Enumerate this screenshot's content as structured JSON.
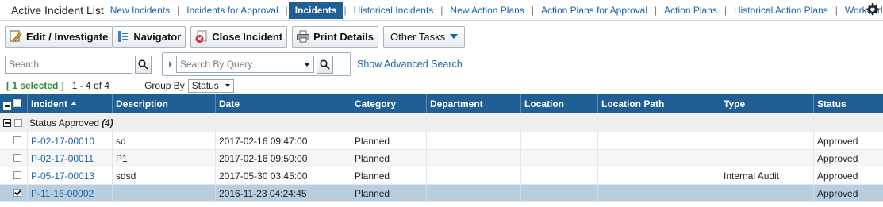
{
  "app_title": "Active Incident List",
  "tabs": [
    {
      "label": "New Incidents"
    },
    {
      "label": "Incidents for Approval"
    },
    {
      "label": "Incidents",
      "active": true
    },
    {
      "label": "Historical Incidents"
    },
    {
      "label": "New Action Plans"
    },
    {
      "label": "Action Plans for Approval"
    },
    {
      "label": "Action Plans"
    },
    {
      "label": "Historical Action Plans"
    },
    {
      "label": "WorkOrd..."
    }
  ],
  "toolbar": {
    "edit_label": "Edit / Investigate",
    "navigator_label": "Navigator",
    "close_label": "Close Incident",
    "print_label": "Print Details",
    "other_label": "Other Tasks"
  },
  "search": {
    "placeholder": "Search",
    "query_placeholder": "Search By Query",
    "advanced_label": "Show Advanced Search"
  },
  "status": {
    "selected": "[ 1 selected ]",
    "count": "1 - 4 of 4",
    "group_by_label": "Group By",
    "group_by_value": "Status"
  },
  "grid": {
    "columns": [
      "Incident",
      "Description",
      "Date",
      "Category",
      "Department",
      "Location",
      "Location Path",
      "Type",
      "Status"
    ],
    "group": {
      "label": "Status Approved",
      "count": "(4)"
    },
    "rows": [
      {
        "incident": "P-02-17-00010",
        "description": "sd",
        "date": "2017-02-16 09:47:00",
        "category": "Planned",
        "department": "",
        "location": "",
        "location_path": "",
        "type": "",
        "status": "Approved",
        "checked": false
      },
      {
        "incident": "P-02-17-00011",
        "description": "P1",
        "date": "2017-02-16 09:50:00",
        "category": "Planned",
        "department": "",
        "location": "",
        "location_path": "",
        "type": "",
        "status": "Approved",
        "checked": false
      },
      {
        "incident": "P-05-17-00013",
        "description": "sdsd",
        "date": "2017-05-30 03:45:00",
        "category": "Planned",
        "department": "",
        "location": "",
        "location_path": "",
        "type": "Internal Audit",
        "status": "Approved",
        "checked": false
      },
      {
        "incident": "P-11-16-00002",
        "description": "",
        "date": "2016-11-23 04:24:45",
        "category": "Planned",
        "department": "",
        "location": "",
        "location_path": "",
        "type": "",
        "status": "Approved",
        "checked": true
      }
    ]
  },
  "colors": {
    "header_blue": "#1f5f96",
    "link_blue": "#1a62a8",
    "selected_green": "#2e8b2e",
    "selected_row": "#b7cde0"
  }
}
